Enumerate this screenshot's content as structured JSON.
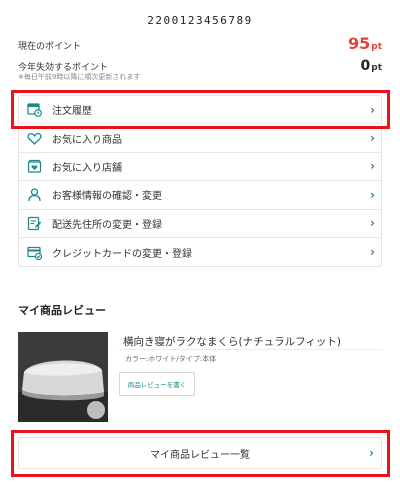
{
  "member": {
    "id": "2200123456789"
  },
  "points": {
    "current_label": "現在のポイント",
    "current_value": "95",
    "current_unit": "pt",
    "expiring_label": "今年失効するポイント",
    "expiring_value": "0",
    "expiring_unit": "pt",
    "note": "※毎日午前9時以降に順次更新されます"
  },
  "menu": {
    "items": [
      {
        "label": "注文履歴",
        "icon": "order-history-icon"
      },
      {
        "label": "お気に入り商品",
        "icon": "heart-icon"
      },
      {
        "label": "お気に入り店舗",
        "icon": "store-icon"
      },
      {
        "label": "お客様情報の確認・変更",
        "icon": "user-icon"
      },
      {
        "label": "配送先住所の変更・登録",
        "icon": "edit-address-icon"
      },
      {
        "label": "クレジットカードの変更・登録",
        "icon": "credit-card-icon"
      }
    ],
    "chevron": "›"
  },
  "reviews": {
    "title": "マイ商品レビュー",
    "product_name": "横向き寝がラクなまくら(ナチュラルフィット)",
    "product_attr": "カラー:ホワイト/タイプ:本体",
    "write_button": "商品レビューを書く",
    "list_button": "マイ商品レビュー一覧"
  },
  "colors": {
    "accent": "#1c8a8a",
    "points_red": "#e0453a",
    "highlight_red": "#e8141c"
  }
}
